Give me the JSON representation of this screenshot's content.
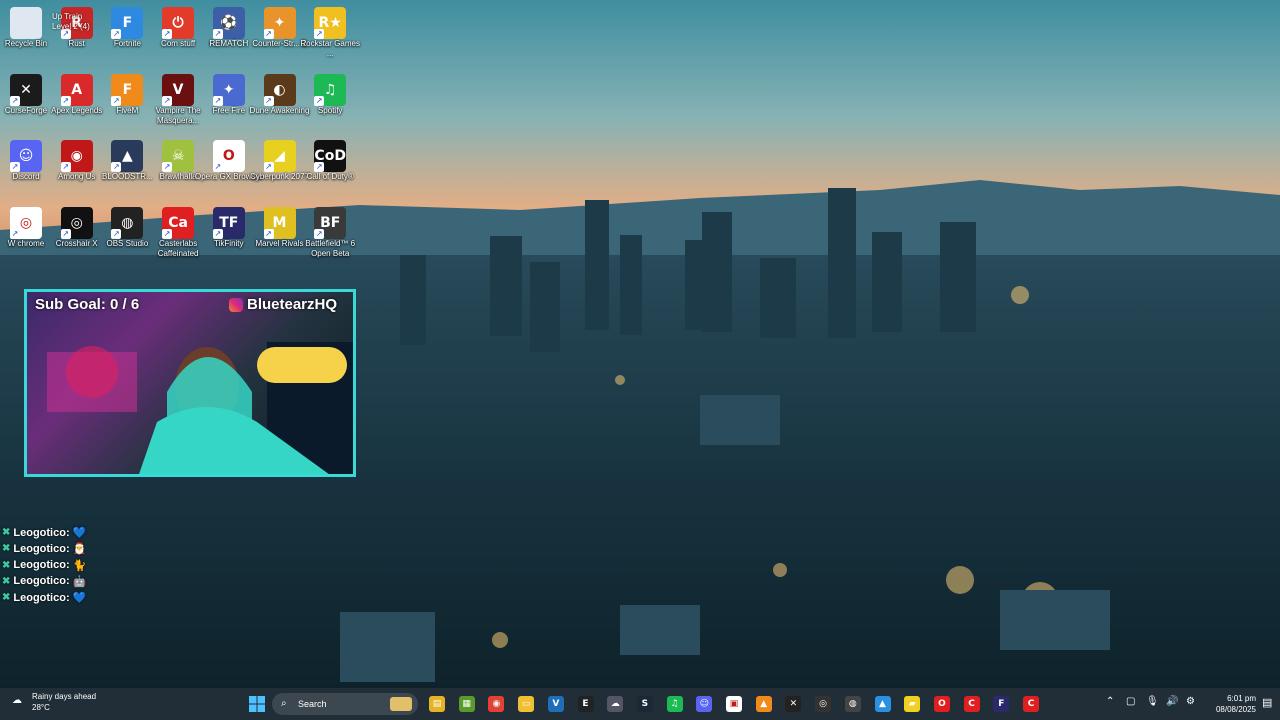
{
  "desktop": {
    "icons": [
      {
        "label": "Recycle Bin",
        "icon": "recycle-bin-icon"
      },
      {
        "label": "Rust",
        "icon": "rust-icon"
      },
      {
        "label": "Fortnite",
        "icon": "fortnite-icon"
      },
      {
        "label": "Com stuff",
        "icon": "power-icon"
      },
      {
        "label": "REMATCH",
        "icon": "rematch-icon"
      },
      {
        "label": "Counter-Str... 2",
        "icon": "counter-strike-icon"
      },
      {
        "label": "Rockstar Games ...",
        "icon": "rockstar-icon"
      },
      {
        "label": "CurseForge",
        "icon": "curseforge-icon"
      },
      {
        "label": "Apex Legends",
        "icon": "apex-icon"
      },
      {
        "label": "FiveM",
        "icon": "fivem-icon"
      },
      {
        "label": "Vampire The Masquera...",
        "icon": "vampire-icon"
      },
      {
        "label": "Free Fire",
        "icon": "free-fire-icon"
      },
      {
        "label": "Dune Awakening",
        "icon": "dune-icon"
      },
      {
        "label": "Spotify",
        "icon": "spotify-icon"
      },
      {
        "label": "Discord",
        "icon": "discord-icon"
      },
      {
        "label": "Among Us",
        "icon": "among-us-icon"
      },
      {
        "label": "BLOODSTR...",
        "icon": "bloodstrike-icon"
      },
      {
        "label": "Brawlhalla",
        "icon": "brawlhalla-icon"
      },
      {
        "label": "Opera GX Browser",
        "icon": "opera-gx-icon"
      },
      {
        "label": "Cyberpunk 2077",
        "icon": "cyberpunk-icon"
      },
      {
        "label": "Call of Duty®",
        "icon": "call-of-duty-icon"
      },
      {
        "label": "W chrome",
        "icon": "chrome-icon"
      },
      {
        "label": "Crosshair X",
        "icon": "crosshair-icon"
      },
      {
        "label": "OBS Studio",
        "icon": "obs-icon"
      },
      {
        "label": "Casterlabs Caffeinated",
        "icon": "casterlabs-icon"
      },
      {
        "label": "TikFinity",
        "icon": "tikfinity-icon"
      },
      {
        "label": "Marvel Rivals",
        "icon": "marvel-rivals-icon"
      },
      {
        "label": "Battlefield™ 6 Open Beta",
        "icon": "battlefield-icon"
      }
    ],
    "icon_glyphs": [
      "",
      "R",
      "F",
      "⏻",
      "⚽",
      "✦",
      "R★",
      "✕",
      "A",
      "F",
      "V",
      "✦",
      "◐",
      "♫",
      "☺",
      "◉",
      "▲",
      "☠",
      "O",
      "◢",
      "CoD",
      "◎",
      "◎",
      "◍",
      "Ca",
      "TF",
      "M",
      "BF"
    ],
    "icon_colors": [
      "#dfe8f0",
      "#c82626",
      "#2e8ae0",
      "#e23b2a",
      "#3c5fa8",
      "#e8942a",
      "#f0c020",
      "#1b1b1b",
      "#d82a2a",
      "#f08a1a",
      "#6a1010",
      "#4a6ad0",
      "#5a3a1a",
      "#1db954",
      "#5865f2",
      "#c01818",
      "#2a3a5a",
      "#a0c040",
      "#fff",
      "#e8d020",
      "#111",
      "#fff",
      "#111",
      "#222",
      "#e02020",
      "#2a2a6a",
      "#e0c020",
      "#3a3a3a"
    ],
    "overlay_text": "Up Train Level 2 (4)"
  },
  "stream_overlay": {
    "sub_goal": "Sub Goal: 0 / 6",
    "handle": "BluetearzHQ"
  },
  "chat": [
    {
      "user": "Leogotico:",
      "emote": "💙"
    },
    {
      "user": "Leogotico:",
      "emote": "🎅"
    },
    {
      "user": "Leogotico:",
      "emote": "🐈"
    },
    {
      "user": "Leogotico:",
      "emote": "🤖"
    },
    {
      "user": "Leogotico:",
      "emote": "💙"
    }
  ],
  "taskbar": {
    "weather": {
      "title": "Rainy days ahead",
      "temp": "28°C"
    },
    "search_placeholder": "Search",
    "clock": {
      "time": "6:01 pm",
      "date": "08/08/2025"
    },
    "apps": [
      {
        "icon": "file-explorer-icon",
        "glyph": "▤",
        "color": "#e6b325"
      },
      {
        "icon": "minecraft-icon",
        "glyph": "▦",
        "color": "#5a9a2a"
      },
      {
        "icon": "chrome-icon",
        "glyph": "◉",
        "color": "#e34133"
      },
      {
        "icon": "folder-icon",
        "glyph": "▭",
        "color": "#f0c030"
      },
      {
        "icon": "vscode-icon",
        "glyph": "V",
        "color": "#1e6fb8"
      },
      {
        "icon": "epic-games-icon",
        "glyph": "E",
        "color": "#222"
      },
      {
        "icon": "onedrive-icon",
        "glyph": "☁",
        "color": "#556"
      },
      {
        "icon": "steam-icon",
        "glyph": "S",
        "color": "#1b2838"
      },
      {
        "icon": "spotify-icon",
        "glyph": "♫",
        "color": "#1db954"
      },
      {
        "icon": "discord-icon",
        "glyph": "☺",
        "color": "#5865f2"
      },
      {
        "icon": "notes-icon",
        "glyph": "▣",
        "color": "#fff"
      },
      {
        "icon": "vlc-icon",
        "glyph": "▲",
        "color": "#f08a1a"
      },
      {
        "icon": "curseforge-icon",
        "glyph": "✕",
        "color": "#222"
      },
      {
        "icon": "obs-icon",
        "glyph": "◎",
        "color": "#333"
      },
      {
        "icon": "network-app-icon",
        "glyph": "◍",
        "color": "#444"
      },
      {
        "icon": "photos-icon",
        "glyph": "▲",
        "color": "#2a90e0"
      },
      {
        "icon": "sticky-notes-icon",
        "glyph": "▰",
        "color": "#f0d020"
      },
      {
        "icon": "opera-icon",
        "glyph": "O",
        "color": "#e02020"
      },
      {
        "icon": "casterlabs-icon",
        "glyph": "C",
        "color": "#e02020"
      },
      {
        "icon": "tikfinity-icon",
        "glyph": "F",
        "color": "#2a2a6a"
      },
      {
        "icon": "casterlabs-2-icon",
        "glyph": "C",
        "color": "#e02020"
      }
    ],
    "tray_glyphs": [
      "⌃",
      "▢",
      "🎙",
      "🔊",
      "⚙"
    ]
  },
  "colors": {
    "sky_top": "#3f8ea0",
    "sky_horizon": "#e7a779",
    "city_dark": "#0f2630",
    "overlay_border": "#38d9d6"
  }
}
